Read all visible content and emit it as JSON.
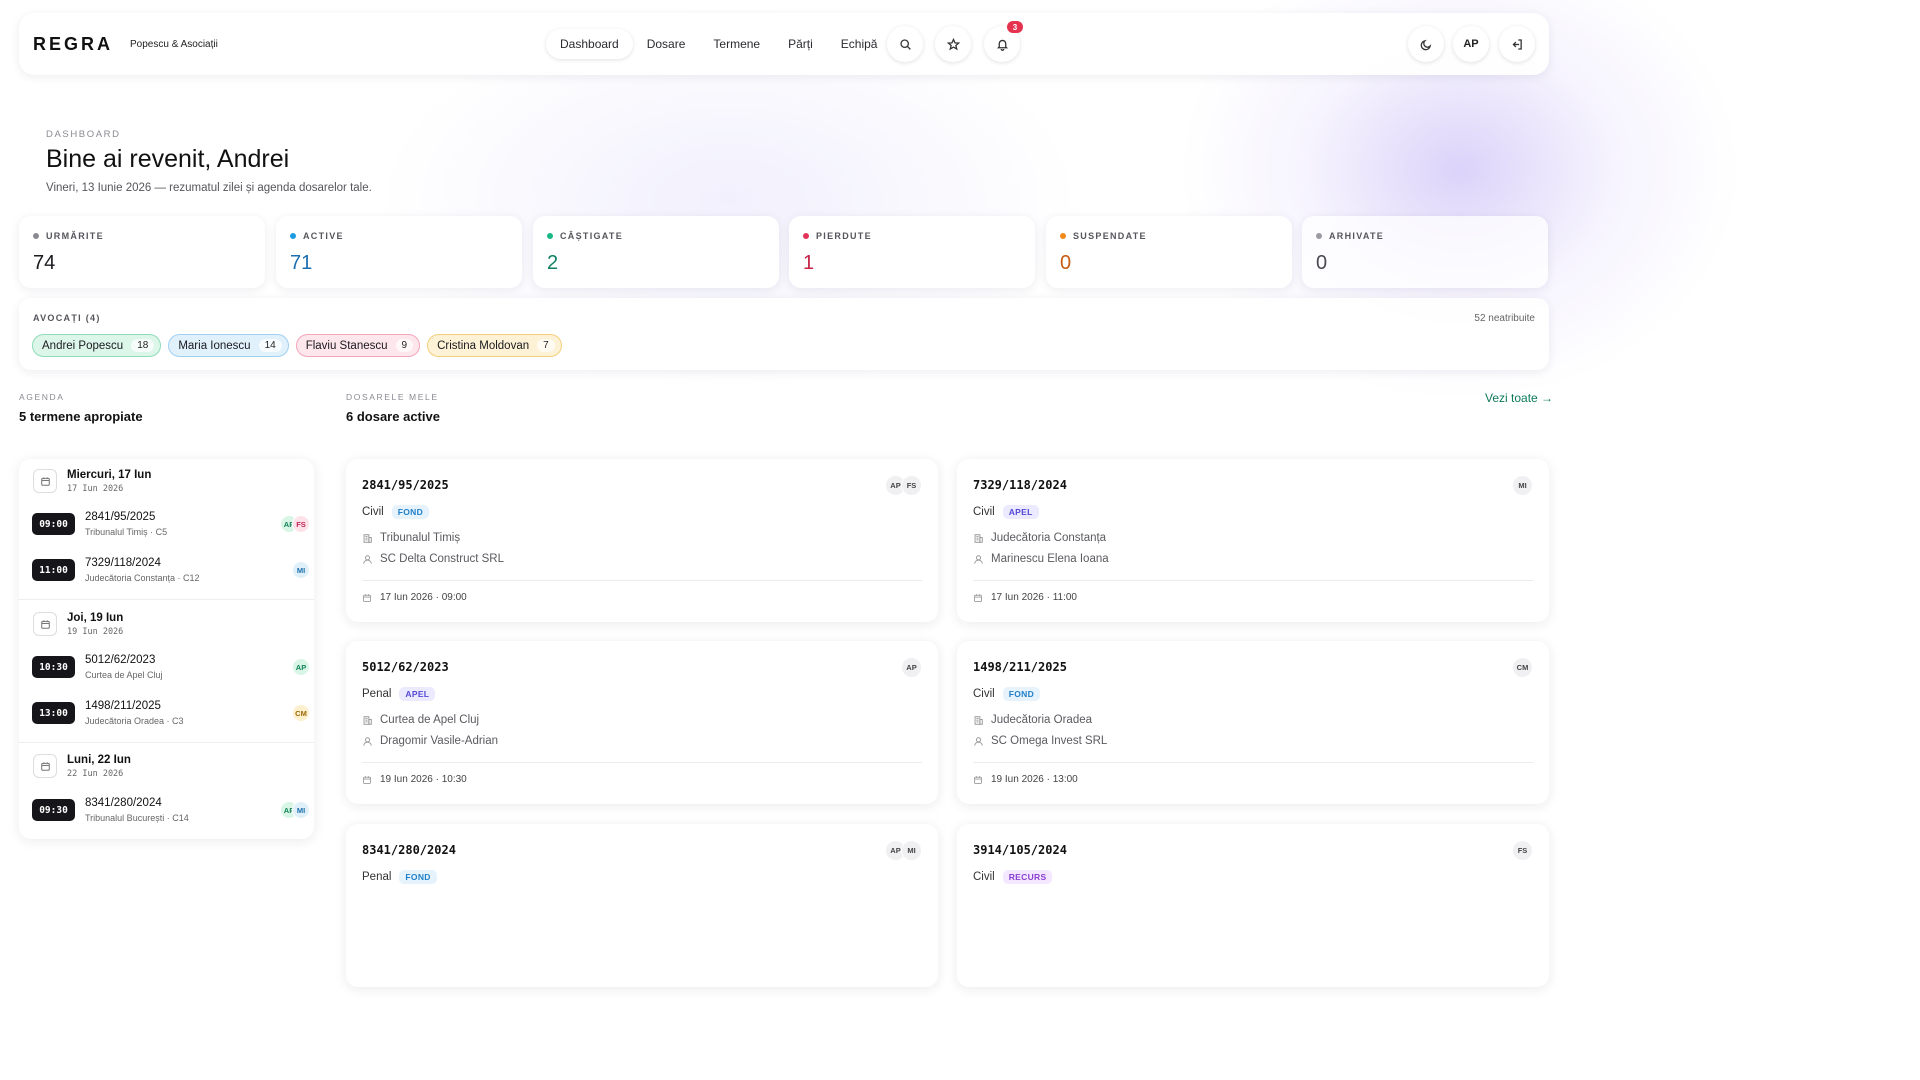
{
  "app": {
    "logo": "REGRA",
    "firm": "Popescu & Asociații"
  },
  "nav": [
    "Dashboard",
    "Dosare",
    "Termene",
    "Părți",
    "Echipă"
  ],
  "nav_active": "Dashboard",
  "header_actions": {
    "notifications_count": "3",
    "user_initials": "AP",
    "icons": [
      "search-icon",
      "star-icon",
      "bell-icon",
      "moon-icon",
      "logout-icon"
    ]
  },
  "intro": {
    "eyebrow": "DASHBOARD",
    "title": "Bine ai revenit, Andrei",
    "subtitle": "Vineri, 13 Iunie 2026 — rezumatul zilei și agenda dosarelor tale."
  },
  "stats": [
    {
      "label": "URMĂRITE",
      "value": "74",
      "color": "#8a8a90",
      "value_color": "#1a1a1f"
    },
    {
      "label": "ACTIVE",
      "value": "71",
      "color": "#1e9be0",
      "value_color": "#1d6fb0"
    },
    {
      "label": "CÂȘTIGATE",
      "value": "2",
      "color": "#19b884",
      "value_color": "#0f7f63"
    },
    {
      "label": "PIERDUTE",
      "value": "1",
      "color": "#e33358",
      "value_color": "#c62447"
    },
    {
      "label": "SUSPENDATE",
      "value": "0",
      "color": "#f08a1a",
      "value_color": "#c65b12"
    },
    {
      "label": "ARHIVATE",
      "value": "0",
      "color": "#9a9aa2",
      "value_color": "#4a4a52"
    }
  ],
  "lawyers": {
    "title": "AVOCAȚI (4)",
    "unassigned": "52 neatribuite",
    "items": [
      {
        "name": "Andrei Popescu",
        "count": "18",
        "bg": "#ddf6ea",
        "border": "#8fdcb8"
      },
      {
        "name": "Maria Ionescu",
        "count": "14",
        "bg": "#e1f1fc",
        "border": "#9fd0f0"
      },
      {
        "name": "Flaviu Stanescu",
        "count": "9",
        "bg": "#fde6ec",
        "border": "#f3a5ba"
      },
      {
        "name": "Cristina Moldovan",
        "count": "7",
        "bg": "#fdf2d6",
        "border": "#f1cf7a"
      }
    ]
  },
  "agenda": {
    "eyebrow": "AGENDA",
    "title": "5 termene apropiate",
    "days": [
      {
        "label": "Miercuri, 17 Iun",
        "date": "17 Iun 2026",
        "items": [
          {
            "time": "09:00",
            "case": "2841/95/2025",
            "court": "Tribunalul Timiș · C5",
            "avatars": [
              "AP",
              "FS"
            ]
          },
          {
            "time": "11:00",
            "case": "7329/118/2024",
            "court": "Judecătoria Constanța · C12",
            "avatars": [
              "MI"
            ]
          }
        ]
      },
      {
        "label": "Joi, 19 Iun",
        "date": "19 Iun 2026",
        "items": [
          {
            "time": "10:30",
            "case": "5012/62/2023",
            "court": "Curtea de Apel Cluj",
            "avatars": [
              "AP"
            ]
          },
          {
            "time": "13:00",
            "case": "1498/211/2025",
            "court": "Judecătoria Oradea · C3",
            "avatars": [
              "CM"
            ]
          }
        ]
      },
      {
        "label": "Luni, 22 Iun",
        "date": "22 Iun 2026",
        "items": [
          {
            "time": "09:30",
            "case": "8341/280/2024",
            "court": "Tribunalul București · C14",
            "avatars": [
              "AP",
              "MI"
            ]
          }
        ]
      }
    ]
  },
  "cases": {
    "eyebrow": "DOSARELE MELE",
    "title": "6 dosare active",
    "view_all": "Vezi toate →",
    "items": [
      {
        "number": "2841/95/2025",
        "type": "Civil",
        "stage": "FOND",
        "court": "Tribunalul Timiș",
        "party": "SC Delta Construct SRL",
        "datetime": "17 Iun 2026 · 09:00",
        "avatars": [
          "AP",
          "FS"
        ]
      },
      {
        "number": "7329/118/2024",
        "type": "Civil",
        "stage": "APEL",
        "court": "Judecătoria Constanța",
        "party": "Marinescu Elena Ioana",
        "datetime": "17 Iun 2026 · 11:00",
        "avatars": [
          "MI"
        ]
      },
      {
        "number": "5012/62/2023",
        "type": "Penal",
        "stage": "APEL",
        "court": "Curtea de Apel Cluj",
        "party": "Dragomir Vasile-Adrian",
        "datetime": "19 Iun 2026 · 10:30",
        "avatars": [
          "AP"
        ]
      },
      {
        "number": "1498/211/2025",
        "type": "Civil",
        "stage": "FOND",
        "court": "Judecătoria Oradea",
        "party": "SC Omega Invest SRL",
        "datetime": "19 Iun 2026 · 13:00",
        "avatars": [
          "CM"
        ]
      },
      {
        "number": "8341/280/2024",
        "type": "Penal",
        "stage": "FOND",
        "avatars": [
          "AP",
          "MI"
        ]
      },
      {
        "number": "3914/105/2024",
        "type": "Civil",
        "stage": "RECURS",
        "avatars": [
          "FS"
        ]
      }
    ]
  },
  "avatar_colors": {
    "AP": {
      "bg": "#d8f5e6",
      "fg": "#13835a"
    },
    "FS": {
      "bg": "#fde2ea",
      "fg": "#c12a54"
    },
    "MI": {
      "bg": "#dff0fb",
      "fg": "#1f6fa8"
    },
    "CM": {
      "bg": "#fdf0cf",
      "fg": "#9a6a07"
    }
  }
}
